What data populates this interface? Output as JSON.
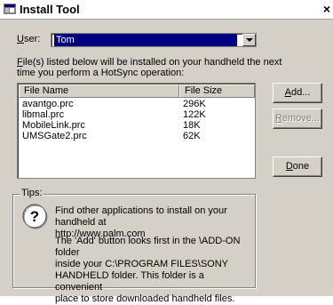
{
  "window": {
    "title": "Install Tool",
    "close_glyph": "×"
  },
  "user": {
    "label_prefix": "",
    "label_mnemonic": "U",
    "label_rest": "ser:",
    "selected": "Tom"
  },
  "instructions": {
    "line1_mnemonic": "F",
    "line1_rest": "ile(s) listed below will be installed on your handheld the next",
    "line2": "time you perform a HotSync operation:"
  },
  "file_list": {
    "columns": [
      "File Name",
      "File Size"
    ],
    "rows": [
      {
        "name": "avantgo.prc",
        "size": "296K"
      },
      {
        "name": "libmal.prc",
        "size": "122K"
      },
      {
        "name": "MobileLink.prc",
        "size": "18K"
      },
      {
        "name": "UMSGate2.prc",
        "size": "62K"
      }
    ]
  },
  "buttons": {
    "add": {
      "mnemonic": "A",
      "rest": "dd..."
    },
    "remove": {
      "mnemonic": "R",
      "rest": "emove..."
    },
    "done": {
      "mnemonic": "D",
      "rest": "one"
    }
  },
  "tips": {
    "title": "Tips:",
    "icon": "question-mark-icon",
    "para1": [
      "Find other applications to install on your handheld at",
      "http://www.palm.com"
    ],
    "para2": [
      "The 'Add' button looks first in the \\ADD-ON folder",
      "inside your C:\\PROGRAM FILES\\SONY",
      "HANDHELD folder. This folder is a convenient",
      "place to store downloaded handheld files."
    ]
  },
  "colors": {
    "face": "#d4d0c8",
    "selection": "#000080",
    "disabled_text": "#808080"
  }
}
